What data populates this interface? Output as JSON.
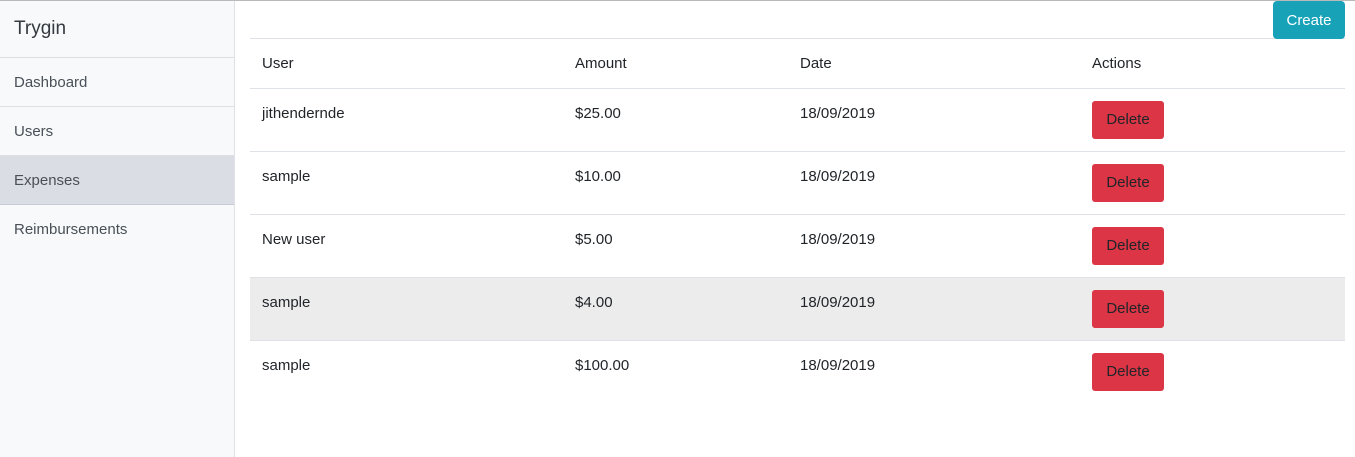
{
  "sidebar": {
    "brand": "Trygin",
    "items": [
      {
        "label": "Dashboard"
      },
      {
        "label": "Users"
      },
      {
        "label": "Expenses",
        "active": true
      },
      {
        "label": "Reimbursements"
      }
    ]
  },
  "toolbar": {
    "create_label": "Create"
  },
  "table": {
    "columns": [
      "User",
      "Amount",
      "Date",
      "Actions"
    ],
    "rows": [
      {
        "user": "jithendernde",
        "amount": "$25.00",
        "date": "18/09/2019",
        "action": "Delete"
      },
      {
        "user": "sample",
        "amount": "$10.00",
        "date": "18/09/2019",
        "action": "Delete"
      },
      {
        "user": "New user",
        "amount": "$5.00",
        "date": "18/09/2019",
        "action": "Delete"
      },
      {
        "user": "sample",
        "amount": "$4.00",
        "date": "18/09/2019",
        "action": "Delete"
      },
      {
        "user": "sample",
        "amount": "$100.00",
        "date": "18/09/2019",
        "action": "Delete"
      }
    ]
  },
  "colors": {
    "create_button": "#17a2b8",
    "delete_button": "#dc3545",
    "active_nav": "#dadde3",
    "hover_row": "#ececec"
  }
}
